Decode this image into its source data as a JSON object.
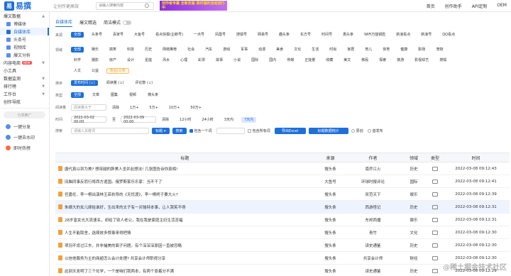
{
  "header": {
    "logo_mark": "易",
    "logo_text": "易撰",
    "slogan": "让创作更高效",
    "search_placeholder": "请输入搜索内容",
    "banner_text": "创作者专属 全新改版 限时福利活动进行中",
    "nav": [
      "首页",
      "创作助手",
      "API定制",
      "OEM"
    ]
  },
  "sidebar": {
    "groups": [
      {
        "label": "爆文数据",
        "items": [
          "博媒体",
          "自媒体库",
          "头条号",
          "视频库",
          "爆文分析"
        ]
      },
      {
        "label": "内容电商",
        "badge": "NEW",
        "items": [
          "小工具"
        ]
      },
      {
        "label": "数据监测"
      },
      {
        "label": "排行榜"
      },
      {
        "label": "工作台"
      },
      {
        "label": "创作导航"
      }
    ],
    "active_item": "自媒体库",
    "promo": "分享推广",
    "tools": [
      "一键分发",
      "一键去水印",
      "即时热榜"
    ]
  },
  "tabs": {
    "items": [
      "自媒体库",
      "爆文精选"
    ],
    "active": "自媒体库",
    "toggle_label": "简洁模式"
  },
  "filters": {
    "source": {
      "label": "来源",
      "options": [
        "全部",
        "头条号",
        "百家号",
        "大鱼号",
        "看点快报(企鹅号)",
        "一点号",
        "凤凰号",
        "搜狐号",
        "网易号",
        "趣头条",
        "东方号",
        "时间号",
        "惠头条",
        "WiFi万能钥匙",
        "新浪看点",
        "新浪号",
        "QQ看点",
        "小"
      ]
    },
    "domain": {
      "label": "领域",
      "rows": [
        [
          "全部",
          "娱乐",
          "搞笑",
          "科技",
          "历史",
          "网络推荐",
          "社会",
          "汽车",
          "游戏",
          "军事",
          "动漫",
          "美食",
          "文化",
          "生活",
          "时尚",
          "家居",
          "育儿",
          "体育",
          "健康",
          "职场",
          "宠物",
          "教"
        ],
        [
          "科学",
          "摄影",
          "房产",
          "设计",
          "星座",
          "风水",
          "心理",
          "彩票",
          "故事",
          "小说",
          "国际",
          "国内",
          "传媒",
          "正能量",
          "收藏",
          "美文",
          "移民",
          "探索",
          "旅游",
          "影视综艺",
          "搜狐"
        ],
        [
          "人文",
          "公益",
          "农业/三农"
        ]
      ]
    },
    "sort": {
      "label": "排序",
      "options": [
        "发布时间 (↓)",
        "阅读量 (↓)",
        "评论数 (↓)"
      ]
    },
    "type": {
      "label": "类型",
      "options": [
        "全部",
        "文章",
        "图集",
        "视频",
        "微头条"
      ]
    },
    "reads": {
      "label": "阅读量",
      "placeholder": "阅读量大于",
      "clear": "清除",
      "options": [
        "1万+",
        "5万+",
        "10万+",
        "50万+"
      ]
    },
    "time": {
      "label": "时间",
      "start": "2022-03-02 00:00",
      "sep": "至",
      "end": "2022-03-09 00:00",
      "clear": "清除",
      "options": [
        "12小时",
        "24小时",
        "3天内",
        "7天内"
      ],
      "active": "7天内"
    },
    "search": {
      "label": "搜索",
      "placeholder": "请输入关键词",
      "mode": "标题",
      "button": "搜索",
      "include_all": "包含一个词",
      "exclude": "包含所有词",
      "export": "导出Excel",
      "analysis": "标题数据统计",
      "original": "原创",
      "first_pub": "首发布"
    }
  },
  "table": {
    "headers": [
      "标题",
      "来源",
      "作者",
      "领域",
      "类型",
      "时间"
    ],
    "rows": [
      {
        "title": "唐代真以到为美? 想穿越的胖美人坐并此想法! 几张图告诉你真相!",
        "source": "搜头条",
        "author": "南乔江火",
        "domain": "历史",
        "time": "2022-03-08 09:12:43"
      },
      {
        "title": "旧脑同事反而行将西方遣国。俄罗斯家乐乐家：当不干了",
        "source": "大鱼号",
        "author": "环球时报评论",
        "domain": "国际",
        "time": "2022-03-08 09:12:41"
      },
      {
        "title": "任嘉伦、李一桐出演林玉菲执导的《无忧渡》，李一桐终于要大火?",
        "source": "搜头条",
        "author": "叹范天下",
        "domain": "娱乐",
        "time": "2022-03-08 09:12:39"
      },
      {
        "title": "朱棣大的女儿嫁给谁好，生出来的太子有一对独特本事，让人哭笑不得",
        "source": "搜头条",
        "author": "西游怪记",
        "domain": "历史",
        "time": "2022-03-08 09:12:31"
      },
      {
        "title": "28岁富女光大流速名，却给了别人老公，我在我是家庭主妇生活苦福",
        "source": "搜头条",
        "author": "东邦西播",
        "domain": "娱乐",
        "time": "2022-03-08 09:12:31"
      },
      {
        "title": "人生不能取舍，选择放多恨事来得把情",
        "source": "搜头条",
        "author": "青竹",
        "domain": "文化",
        "time": "2022-03-08 09:12:30"
      },
      {
        "title": "项羽不肯过江东，并非捕美的面子问题，有个深深深原因一直被忽略",
        "source": "搜头条",
        "author": "读史通鉴",
        "domain": "历史",
        "time": "2022-03-08 09:12:30"
      },
      {
        "title": "以信他服务为主的商超怎么会计处理? 共享会计师职视分享",
        "source": "搜头条",
        "author": "共享会计师",
        "domain": "财经",
        "time": "2022-03-08 09:12:30"
      },
      {
        "title": "此刻天发明了三个化学，一个是咱们我两本，有两个靠着分不满",
        "source": "搜头条",
        "author": "读史通鉴",
        "domain": "历史",
        "time": "2022-03-08 09:12:29"
      }
    ],
    "highlighted_row": 3
  },
  "watermark": "@稀土掘金技术社区",
  "colors": {
    "accent": "#1e6fd9",
    "highlight": "#eef4ff",
    "badge": "#ff4d4f"
  }
}
